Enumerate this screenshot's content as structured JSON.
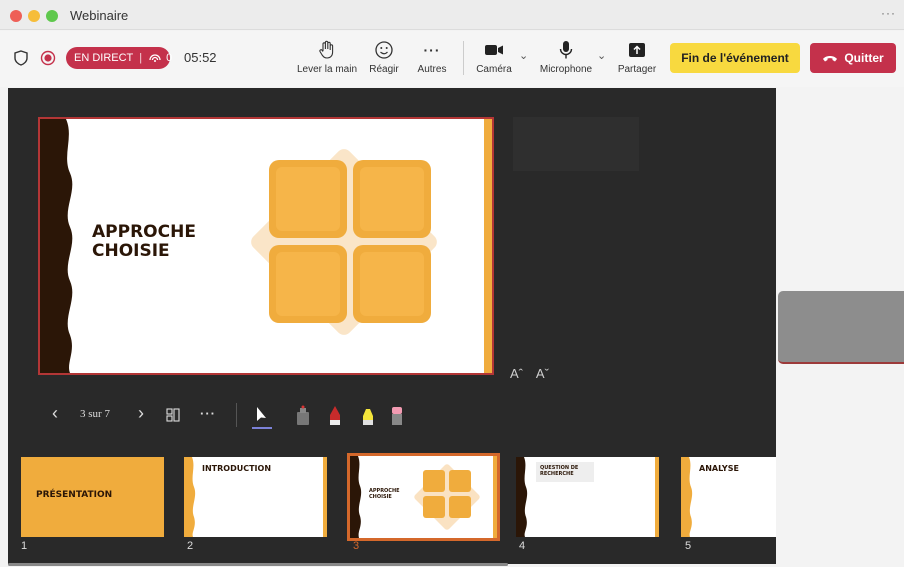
{
  "window": {
    "title": "Webinaire",
    "more": "···"
  },
  "toolbar": {
    "live_label": "EN DIRECT",
    "viewer_count": "0",
    "timer": "05:52",
    "raise_hand": "Lever la main",
    "react": "Réagir",
    "more": "Autres",
    "camera": "Caméra",
    "microphone": "Microphone",
    "share": "Partager",
    "end_event": "Fin de l'événement",
    "quit": "Quitter"
  },
  "presentation": {
    "slide_title_line1": "APPROCHE",
    "slide_title_line2": "CHOISIE",
    "font_increase": "Aˆ",
    "font_decrease": "Aˇ",
    "page_indicator": "3 sur 7",
    "nav_more": "···"
  },
  "thumbnails": [
    {
      "num": "1",
      "label": "PRÉSENTATION"
    },
    {
      "num": "2",
      "label": "INTRODUCTION"
    },
    {
      "num": "3",
      "label_line1": "APPROCHE",
      "label_line2": "CHOISIE"
    },
    {
      "num": "4",
      "label_line1": "QUESTION DE",
      "label_line2": "RECHERCHE"
    },
    {
      "num": "5",
      "label": "ANALYSE"
    }
  ],
  "colors": {
    "live_red": "#c4314b",
    "end_yellow": "#f8d93f",
    "slide_orange": "#f0ac3d",
    "slide_brown": "#2b1607",
    "active_thumb_border": "#d4682b"
  }
}
